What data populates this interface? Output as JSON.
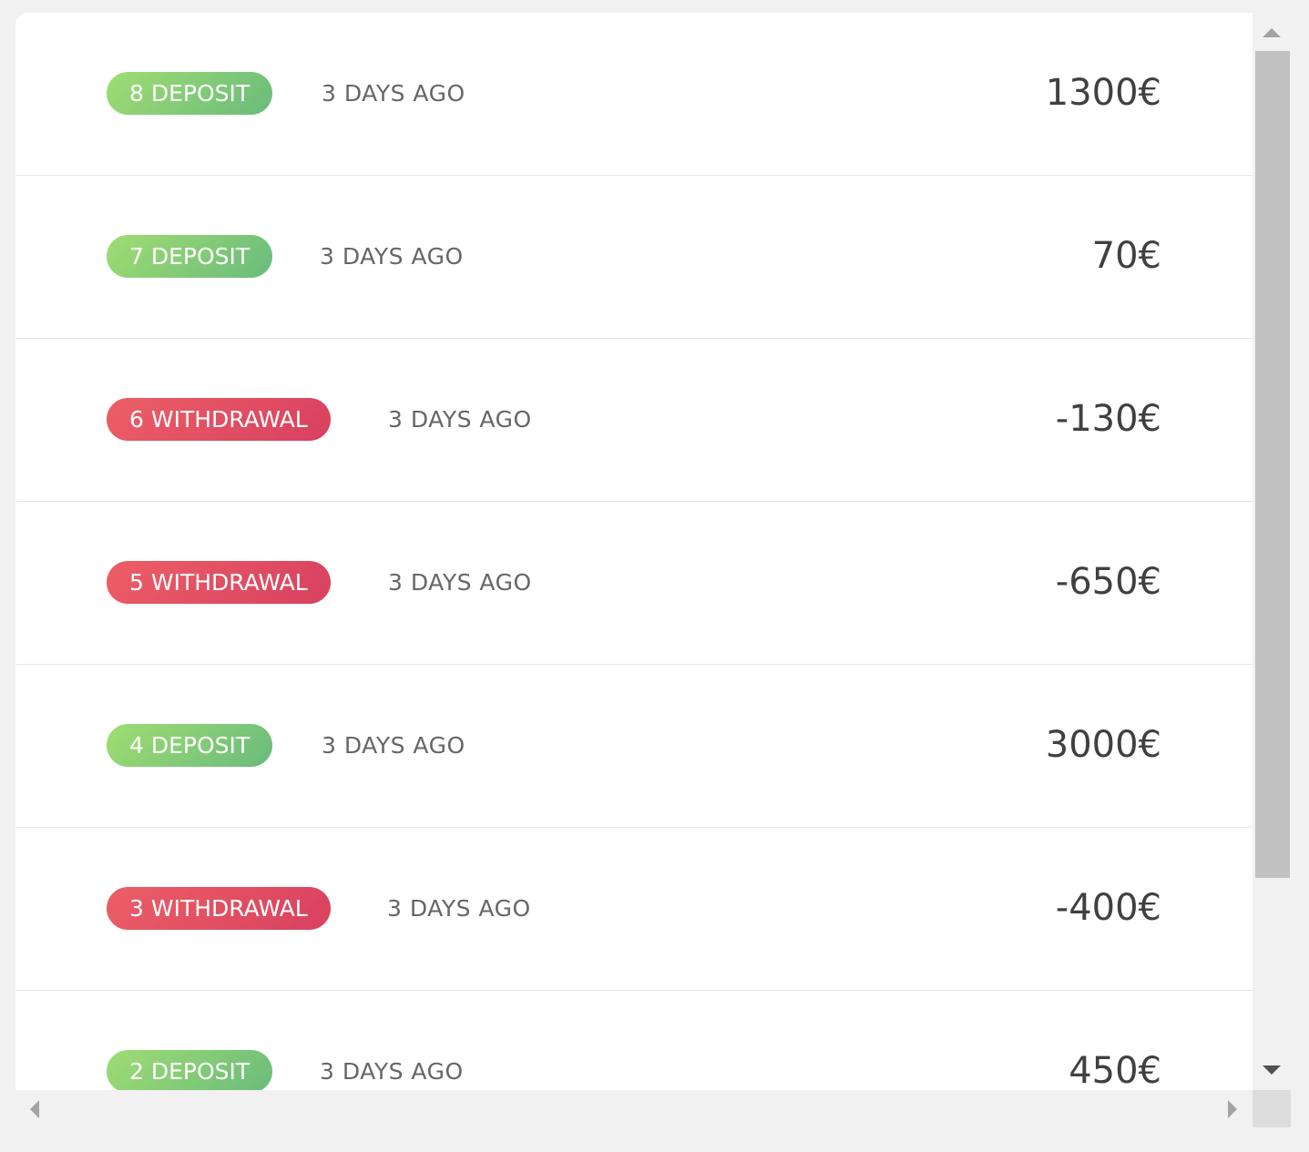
{
  "transactions": [
    {
      "label": "8 DEPOSIT",
      "type": "deposit",
      "time": "3 DAYS AGO",
      "amount": "1300€"
    },
    {
      "label": "7 DEPOSIT",
      "type": "deposit",
      "time": "3 DAYS AGO",
      "amount": "70€"
    },
    {
      "label": "6 WITHDRAWAL",
      "type": "withdrawal",
      "time": "3 DAYS AGO",
      "amount": "-130€"
    },
    {
      "label": "5 WITHDRAWAL",
      "type": "withdrawal",
      "time": "3 DAYS AGO",
      "amount": "-650€"
    },
    {
      "label": "4 DEPOSIT",
      "type": "deposit",
      "time": "3 DAYS AGO",
      "amount": "3000€"
    },
    {
      "label": "3 WITHDRAWAL",
      "type": "withdrawal",
      "time": "3 DAYS AGO",
      "amount": "-400€"
    },
    {
      "label": "2 DEPOSIT",
      "type": "deposit",
      "time": "3 DAYS AGO",
      "amount": "450€"
    }
  ],
  "colors": {
    "deposit_start": "#9fdd72",
    "deposit_end": "#6abb7c",
    "withdrawal_start": "#ec5f66",
    "withdrawal_end": "#d84060",
    "text_muted": "#666666",
    "amount_text": "#404040"
  },
  "icons": {
    "scroll_up": "triangle-up-icon",
    "scroll_down": "triangle-down-icon",
    "scroll_left": "triangle-left-icon",
    "scroll_right": "triangle-right-icon"
  }
}
